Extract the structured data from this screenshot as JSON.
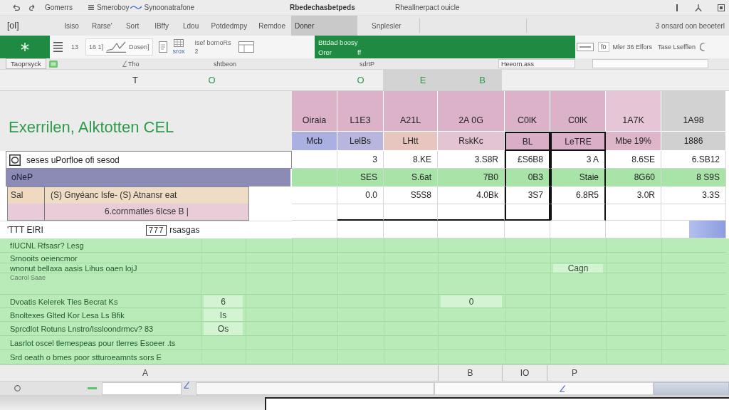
{
  "title_bar": {
    "quick_access_label": "Gomerrs",
    "document_path": "Smeroboy",
    "document_name": "Synoonatrafone",
    "app_title": "Rbedechasbetpeds",
    "subtitle": "Rheallnerpact ouicle"
  },
  "ribbon_tabs": {
    "file_label": "[oI]",
    "tabs": [
      {
        "label": "Isiso",
        "selected": false
      },
      {
        "label": "Rarse'",
        "selected": false
      },
      {
        "label": "Sort",
        "selected": false
      },
      {
        "label": "IBffy",
        "selected": false
      },
      {
        "label": "Ldou",
        "selected": false
      },
      {
        "label": "Potdedmpy",
        "selected": false
      },
      {
        "label": "Remdoe",
        "selected": false
      },
      {
        "label": "Doner",
        "selected": true
      },
      {
        "label": "Snplesler",
        "selected": false
      }
    ],
    "account": "3 onsard oon beoeterl"
  },
  "ribbon": {
    "number_label": "13",
    "chart_box_label": "16 1]",
    "chart_label": "Dosen]",
    "tool_label": "srox",
    "format_label": "Isef bornoRs",
    "format_value": "2",
    "banner_title": "Bttdad boosy",
    "banner_label": "Orer",
    "banner_value": "ff",
    "zoom_value": "f0",
    "option_1": "Mler 36 Elfors",
    "option_2": "Tase Lsefflen"
  },
  "label_bar": {
    "sheet_tab": "Taoprsyck",
    "group_1": "Tho",
    "group_2": "shtbeon",
    "group_3": "sdrtP",
    "name_box": "Heeorn.ass"
  },
  "column_headers": [
    {
      "label": "T",
      "selected": false,
      "color": "#333333"
    },
    {
      "label": "O",
      "selected": false,
      "color": "#2a9a48"
    },
    {
      "label": "O",
      "selected": false,
      "color": "#2a9a48"
    },
    {
      "label": "E",
      "selected": true,
      "color": "#2a9a48"
    },
    {
      "label": "B",
      "selected": true,
      "color": "#2a9a48"
    }
  ],
  "sheet_title": "Exerrilen, Alktotten CEL",
  "summary": {
    "heading": "seses uPorfloe ofi sesod",
    "band_label": "oNeP",
    "box_label": "Sal",
    "box_line_1": "(S) Gnyéanc Isfe- (S) Atnansr eat",
    "box_line_2": "6.cornmatles 6lcse B |",
    "footer_label": "'TTT EIRI",
    "footer_tag": "777",
    "footer_text": "rsasgas"
  },
  "table": {
    "header": [
      {
        "text": "Oiraia",
        "color": "#dcb2c8"
      },
      {
        "text": "L1E3",
        "color": "#dcb2c8"
      },
      {
        "text": "A21L",
        "color": "#dcb2c8"
      },
      {
        "text": "2A 0G",
        "color": "#dcb2c8"
      },
      {
        "text": "C0lK",
        "color": "#dcb2c8"
      },
      {
        "text": "C0lK",
        "color": "#dcb2c8"
      },
      {
        "text": "1A7K",
        "color": "#e6c6d6"
      },
      {
        "text": "1A98",
        "color": "#d2d2d2"
      }
    ],
    "subheader": [
      {
        "text": "Mcb",
        "color": "#aab0e2",
        "selected": false
      },
      {
        "text": "LelBs",
        "color": "#b8b6de",
        "selected": false
      },
      {
        "text": "LHtt",
        "color": "#e8c6c0",
        "selected": false
      },
      {
        "text": "RskKc",
        "color": "#e2c4d2",
        "selected": false
      },
      {
        "text": "BL",
        "color": "#d9aec6",
        "selected": true
      },
      {
        "text": "LeTRE",
        "color": "#d9aec6",
        "selected": true
      },
      {
        "text": "Mbe 19%",
        "color": "#deb6ca",
        "selected": false
      },
      {
        "text": "1886",
        "color": "#d0d0d0",
        "selected": false
      }
    ],
    "rows": [
      {
        "highlighted": false,
        "cells": [
          "3",
          "8.KE",
          "3.S8R",
          "£S6B8",
          "3 A",
          "8.6SE",
          "6.SB12"
        ]
      },
      {
        "highlighted": true,
        "cells": [
          "SES",
          "S.6at",
          "7B0",
          "0B3",
          "Staie",
          "8G60",
          "8 S9S"
        ]
      },
      {
        "highlighted": false,
        "cells": [
          "0.0",
          "S5S8",
          "4.0Bk",
          "3S7",
          "6.8R5",
          "3.0R",
          "3.3S"
        ]
      }
    ]
  },
  "notes": [
    {
      "kind": "text",
      "text": "fIUCNL Rfsasr? Lesg"
    },
    {
      "kind": "text",
      "text": "Srnooits oeiencmor"
    },
    {
      "kind": "text",
      "text": "wnonut bellaxa aasis Lihus oaen lojJ",
      "column_8": "Cagn"
    },
    {
      "kind": "caption",
      "text": "Caorol Saae"
    },
    {
      "kind": "text",
      "text": "Dvoatis Kelerek Tles Becrat Ks",
      "column_1": "6",
      "column_6": "0"
    },
    {
      "kind": "text",
      "text": "Bnoltexes Glted Kor Lesa Ls Bfik",
      "column_1": "Is"
    },
    {
      "kind": "text",
      "text": "Sprcdlot Rotuns Lnstro/Issloondrmcv? 83",
      "column_1": "Os"
    },
    {
      "kind": "text",
      "text": "Lasrlot oscel tlemespeas pour tlerres Esoeer .ts"
    },
    {
      "kind": "text",
      "text": "Srd oeath o bmes poor stturoeamnts sors E"
    }
  ],
  "column_letters": [
    "A",
    "B",
    "IO",
    "P"
  ]
}
